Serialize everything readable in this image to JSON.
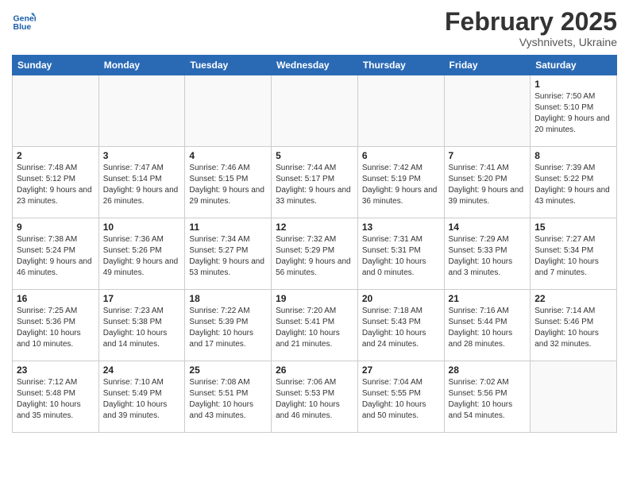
{
  "header": {
    "logo_general": "General",
    "logo_blue": "Blue",
    "month_title": "February 2025",
    "location": "Vyshnivets, Ukraine"
  },
  "days_of_week": [
    "Sunday",
    "Monday",
    "Tuesday",
    "Wednesday",
    "Thursday",
    "Friday",
    "Saturday"
  ],
  "weeks": [
    [
      {
        "day": "",
        "info": ""
      },
      {
        "day": "",
        "info": ""
      },
      {
        "day": "",
        "info": ""
      },
      {
        "day": "",
        "info": ""
      },
      {
        "day": "",
        "info": ""
      },
      {
        "day": "",
        "info": ""
      },
      {
        "day": "1",
        "info": "Sunrise: 7:50 AM\nSunset: 5:10 PM\nDaylight: 9 hours and 20 minutes."
      }
    ],
    [
      {
        "day": "2",
        "info": "Sunrise: 7:48 AM\nSunset: 5:12 PM\nDaylight: 9 hours and 23 minutes."
      },
      {
        "day": "3",
        "info": "Sunrise: 7:47 AM\nSunset: 5:14 PM\nDaylight: 9 hours and 26 minutes."
      },
      {
        "day": "4",
        "info": "Sunrise: 7:46 AM\nSunset: 5:15 PM\nDaylight: 9 hours and 29 minutes."
      },
      {
        "day": "5",
        "info": "Sunrise: 7:44 AM\nSunset: 5:17 PM\nDaylight: 9 hours and 33 minutes."
      },
      {
        "day": "6",
        "info": "Sunrise: 7:42 AM\nSunset: 5:19 PM\nDaylight: 9 hours and 36 minutes."
      },
      {
        "day": "7",
        "info": "Sunrise: 7:41 AM\nSunset: 5:20 PM\nDaylight: 9 hours and 39 minutes."
      },
      {
        "day": "8",
        "info": "Sunrise: 7:39 AM\nSunset: 5:22 PM\nDaylight: 9 hours and 43 minutes."
      }
    ],
    [
      {
        "day": "9",
        "info": "Sunrise: 7:38 AM\nSunset: 5:24 PM\nDaylight: 9 hours and 46 minutes."
      },
      {
        "day": "10",
        "info": "Sunrise: 7:36 AM\nSunset: 5:26 PM\nDaylight: 9 hours and 49 minutes."
      },
      {
        "day": "11",
        "info": "Sunrise: 7:34 AM\nSunset: 5:27 PM\nDaylight: 9 hours and 53 minutes."
      },
      {
        "day": "12",
        "info": "Sunrise: 7:32 AM\nSunset: 5:29 PM\nDaylight: 9 hours and 56 minutes."
      },
      {
        "day": "13",
        "info": "Sunrise: 7:31 AM\nSunset: 5:31 PM\nDaylight: 10 hours and 0 minutes."
      },
      {
        "day": "14",
        "info": "Sunrise: 7:29 AM\nSunset: 5:33 PM\nDaylight: 10 hours and 3 minutes."
      },
      {
        "day": "15",
        "info": "Sunrise: 7:27 AM\nSunset: 5:34 PM\nDaylight: 10 hours and 7 minutes."
      }
    ],
    [
      {
        "day": "16",
        "info": "Sunrise: 7:25 AM\nSunset: 5:36 PM\nDaylight: 10 hours and 10 minutes."
      },
      {
        "day": "17",
        "info": "Sunrise: 7:23 AM\nSunset: 5:38 PM\nDaylight: 10 hours and 14 minutes."
      },
      {
        "day": "18",
        "info": "Sunrise: 7:22 AM\nSunset: 5:39 PM\nDaylight: 10 hours and 17 minutes."
      },
      {
        "day": "19",
        "info": "Sunrise: 7:20 AM\nSunset: 5:41 PM\nDaylight: 10 hours and 21 minutes."
      },
      {
        "day": "20",
        "info": "Sunrise: 7:18 AM\nSunset: 5:43 PM\nDaylight: 10 hours and 24 minutes."
      },
      {
        "day": "21",
        "info": "Sunrise: 7:16 AM\nSunset: 5:44 PM\nDaylight: 10 hours and 28 minutes."
      },
      {
        "day": "22",
        "info": "Sunrise: 7:14 AM\nSunset: 5:46 PM\nDaylight: 10 hours and 32 minutes."
      }
    ],
    [
      {
        "day": "23",
        "info": "Sunrise: 7:12 AM\nSunset: 5:48 PM\nDaylight: 10 hours and 35 minutes."
      },
      {
        "day": "24",
        "info": "Sunrise: 7:10 AM\nSunset: 5:49 PM\nDaylight: 10 hours and 39 minutes."
      },
      {
        "day": "25",
        "info": "Sunrise: 7:08 AM\nSunset: 5:51 PM\nDaylight: 10 hours and 43 minutes."
      },
      {
        "day": "26",
        "info": "Sunrise: 7:06 AM\nSunset: 5:53 PM\nDaylight: 10 hours and 46 minutes."
      },
      {
        "day": "27",
        "info": "Sunrise: 7:04 AM\nSunset: 5:55 PM\nDaylight: 10 hours and 50 minutes."
      },
      {
        "day": "28",
        "info": "Sunrise: 7:02 AM\nSunset: 5:56 PM\nDaylight: 10 hours and 54 minutes."
      },
      {
        "day": "",
        "info": ""
      }
    ]
  ]
}
